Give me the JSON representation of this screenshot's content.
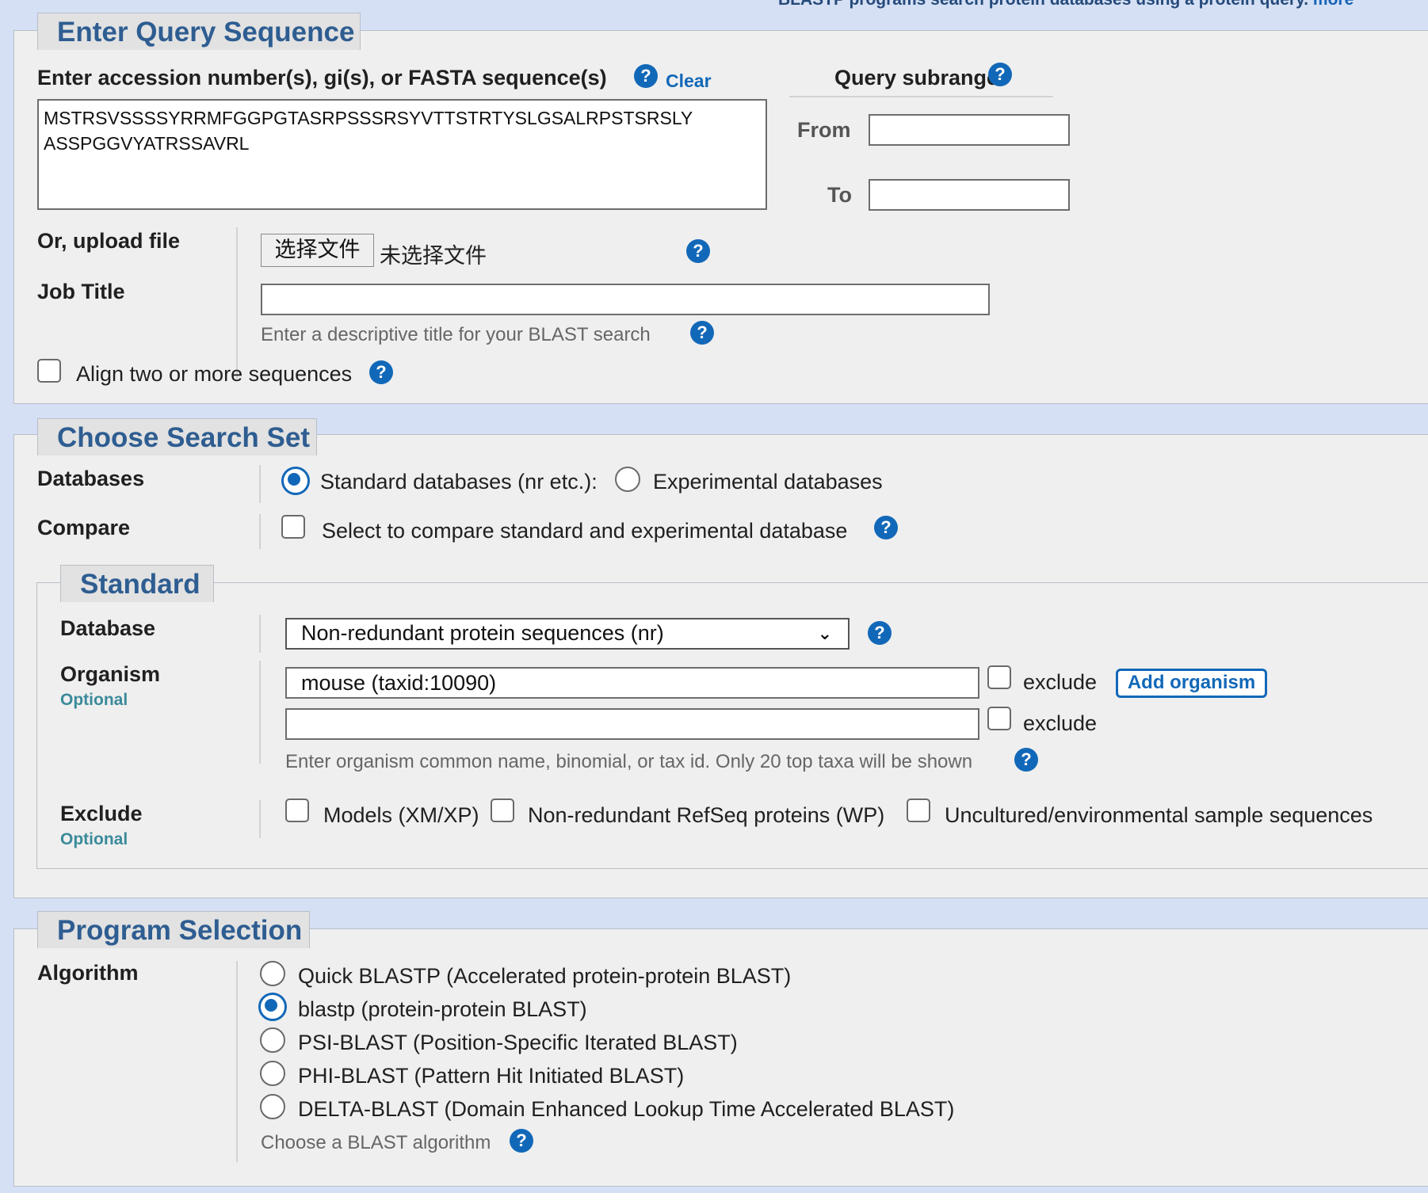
{
  "top_note": {
    "text": "BLASTP programs search protein databases using a protein query.",
    "more": "more"
  },
  "query": {
    "title": "Enter Query Sequence",
    "accession_label": "Enter accession number(s), gi(s), or FASTA sequence(s)",
    "clear_label": "Clear",
    "sequence_value": "MSTRSVSSSSYRRMFGGPGTASRPSSSRSYVTTSTRTYSLGSALRPSTSRSLY\nASSPGGVYATRSSAVRL",
    "subrange_label": "Query subrange",
    "from_label": "From",
    "to_label": "To",
    "from_value": "",
    "to_value": "",
    "upload_label": "Or, upload file",
    "choose_file_button": "选择文件",
    "no_file_text": "未选择文件",
    "job_title_label": "Job Title",
    "job_title_value": "",
    "job_title_hint": "Enter a descriptive title for your BLAST search",
    "align_label": "Align two or more sequences"
  },
  "search_set": {
    "title": "Choose Search Set",
    "databases_label": "Databases",
    "standard_db_label": "Standard databases (nr etc.):",
    "experimental_db_label": "Experimental databases",
    "compare_label": "Compare",
    "compare_text": "Select to compare standard and experimental database",
    "standard": {
      "title": "Standard",
      "database_label": "Database",
      "database_value": "Non-redundant protein sequences (nr)",
      "organism_label": "Organism",
      "optional_label": "Optional",
      "organism_value": "mouse (taxid:10090)",
      "organism_value_2": "",
      "exclude_label": "exclude",
      "add_organism_button": "Add organism",
      "organism_hint": "Enter organism common name, binomial, or tax id. Only 20 top taxa will be shown",
      "exclude_section_label": "Exclude",
      "exclude_models": "Models (XM/XP)",
      "exclude_refseq": "Non-redundant RefSeq proteins (WP)",
      "exclude_uncultured": "Uncultured/environmental sample sequences"
    }
  },
  "program": {
    "title": "Program Selection",
    "algorithm_label": "Algorithm",
    "options": [
      {
        "label": "Quick BLASTP (Accelerated protein-protein BLAST)",
        "selected": false
      },
      {
        "label": "blastp (protein-protein BLAST)",
        "selected": true
      },
      {
        "label": "PSI-BLAST (Position-Specific Iterated BLAST)",
        "selected": false
      },
      {
        "label": "PHI-BLAST (Pattern Hit Initiated BLAST)",
        "selected": false
      },
      {
        "label": "DELTA-BLAST (Domain Enhanced Lookup Time Accelerated BLAST)",
        "selected": false
      }
    ],
    "hint": "Choose a BLAST algorithm"
  },
  "colors": {
    "accent": "#1268b8",
    "legend_text": "#2e5d91",
    "page_bg": "#d5e0f5",
    "panel_bg": "#efefef"
  }
}
